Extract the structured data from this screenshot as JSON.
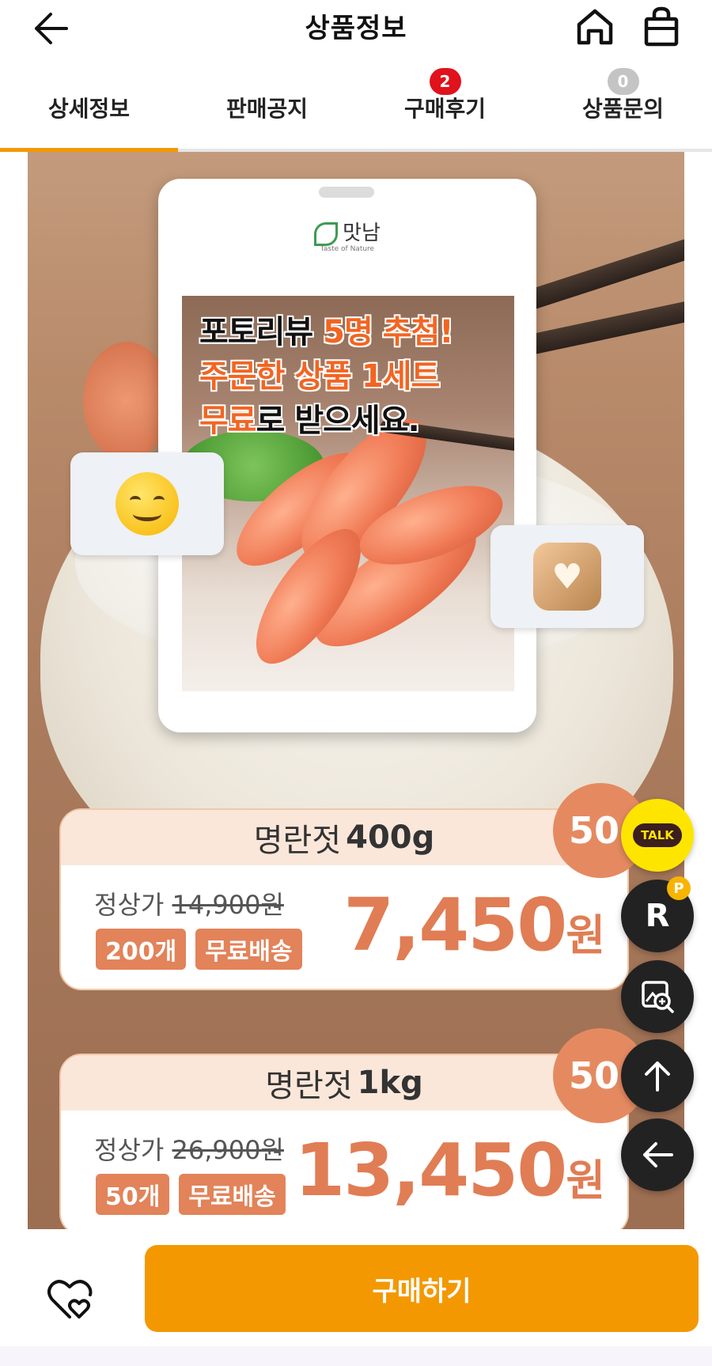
{
  "header": {
    "title": "상품정보",
    "back_icon": "arrow-left-icon",
    "home_icon": "home-icon",
    "bag_icon": "shopping-bag-icon"
  },
  "tabs": [
    {
      "label": "상세정보",
      "badge": null,
      "active": true
    },
    {
      "label": "판매공지",
      "badge": null,
      "active": false
    },
    {
      "label": "구매후기",
      "badge": "2",
      "active": false
    },
    {
      "label": "상품문의",
      "badge": "0",
      "active": false
    }
  ],
  "banner": {
    "brand": "맛남",
    "brand_sub": "Taste of Nature",
    "headline_1a": "포토리뷰 ",
    "headline_1b": "5명 추첨!",
    "headline_2": "주문한 상품 1세트",
    "headline_3a": "무료",
    "headline_3b": "로 받으세요."
  },
  "products": [
    {
      "name": "명란젓",
      "weight": "400g",
      "regular_label": "정상가",
      "regular_price": "14,900원",
      "qty_tag": "200개",
      "shipping_tag": "무료배송",
      "price": "7,450",
      "price_unit": "원",
      "discount": "50"
    },
    {
      "name": "명란젓",
      "weight": "1kg",
      "regular_label": "정상가",
      "regular_price": "26,900원",
      "qty_tag": "50개",
      "shipping_tag": "무료배송",
      "price": "13,450",
      "price_unit": "원",
      "discount": "50"
    }
  ],
  "floating": {
    "talk_label": "TALK",
    "r_label": "R",
    "coin_label": "P"
  },
  "bottom": {
    "buy_label": "구매하기",
    "wish_icon": "heart-icon"
  },
  "colors": {
    "accent": "#f39800",
    "badge_red": "#e0121b",
    "price": "#e07d54",
    "kakao": "#fee500"
  }
}
